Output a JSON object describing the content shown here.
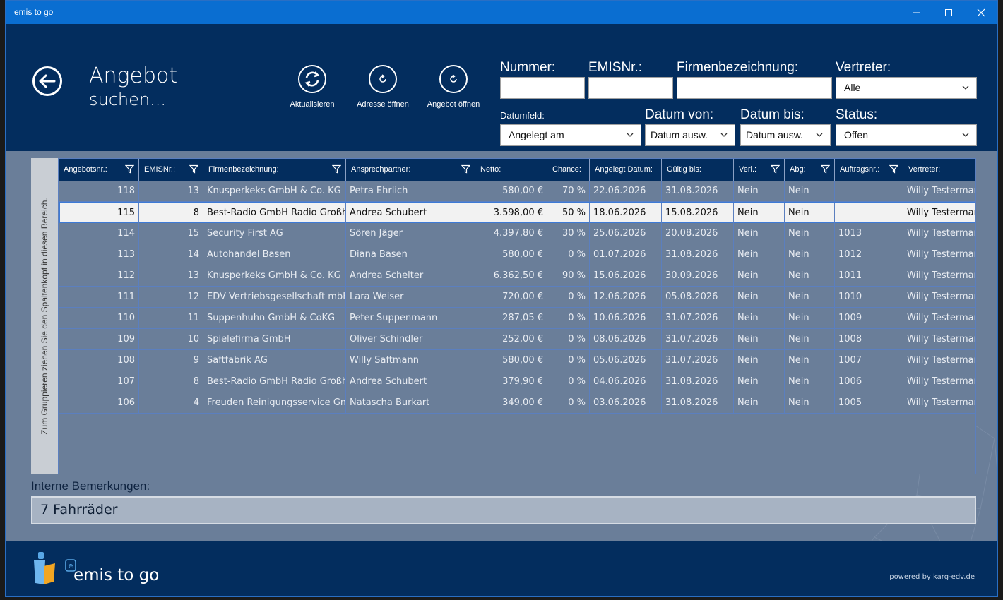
{
  "window": {
    "title": "emis to go",
    "controls": [
      "minimize",
      "maximize",
      "close"
    ]
  },
  "header": {
    "title_line1": "Angebot",
    "title_line2": "suchen...",
    "buttons": [
      {
        "label": "Aktualisieren",
        "icon": "refresh-icon"
      },
      {
        "label": "Adresse öffnen",
        "icon": "refresh-small-icon"
      },
      {
        "label": "Angebot öffnen",
        "icon": "refresh-small-icon"
      }
    ]
  },
  "filters": {
    "nummer_label": "Nummer:",
    "nummer_value": "",
    "emisnr_label": "EMISNr.:",
    "emisnr_value": "",
    "firma_label": "Firmenbezeichnung:",
    "firma_value": "",
    "vertreter_label": "Vertreter:",
    "vertreter_value": "Alle",
    "datumfeld_label": "Datumfeld:",
    "datumfeld_value": "Angelegt am",
    "datum_von_label": "Datum von:",
    "datum_von_value": "Datum ausw.",
    "datum_bis_label": "Datum bis:",
    "datum_bis_value": "Datum ausw.",
    "status_label": "Status:",
    "status_value": "Offen"
  },
  "grid": {
    "group_hint": "Zum Gruppieren ziehen Sie den Spaltenkopf in diesen Bereich.",
    "columns": [
      {
        "label": "Angebotsnr.:",
        "filter": true
      },
      {
        "label": "EMISNr.:",
        "filter": true
      },
      {
        "label": "Firmenbezeichnung:",
        "filter": true
      },
      {
        "label": "Ansprechpartner:",
        "filter": true
      },
      {
        "label": "Netto:",
        "filter": false
      },
      {
        "label": "Chance:",
        "filter": false
      },
      {
        "label": "Angelegt Datum:",
        "filter": false
      },
      {
        "label": "Gültig bis:",
        "filter": false
      },
      {
        "label": "Verl.:",
        "filter": true
      },
      {
        "label": "Abg:",
        "filter": true
      },
      {
        "label": "Auftragsnr.:",
        "filter": true
      },
      {
        "label": "Vertreter:",
        "filter": false
      }
    ],
    "selected_row": 1,
    "rows": [
      [
        "118",
        "13",
        "Knusperkeks GmbH & Co. KG",
        "Petra Ehrlich",
        "580,00 €",
        "70 %",
        "22.06.2026",
        "31.08.2026",
        "Nein",
        "Nein",
        "",
        "Willy Testermann"
      ],
      [
        "115",
        "8",
        "Best-Radio GmbH Radio Großhandel",
        "Andrea Schubert",
        "3.598,00 €",
        "50 %",
        "18.06.2026",
        "15.08.2026",
        "Nein",
        "Nein",
        "",
        "Willy Testermann"
      ],
      [
        "114",
        "15",
        "Security First AG",
        "Sören Jäger",
        "4.397,80 €",
        "30 %",
        "25.06.2026",
        "20.08.2026",
        "Nein",
        "Nein",
        "1013",
        "Willy Testermann"
      ],
      [
        "113",
        "14",
        "Autohandel Basen",
        "Diana Basen",
        "580,00 €",
        "0 %",
        "01.07.2026",
        "31.08.2026",
        "Nein",
        "Nein",
        "1012",
        "Willy Testermann"
      ],
      [
        "112",
        "13",
        "Knusperkeks GmbH & Co. KG",
        "Andrea Schelter",
        "6.362,50 €",
        "90 %",
        "15.06.2026",
        "30.09.2026",
        "Nein",
        "Nein",
        "1011",
        "Willy Testermann"
      ],
      [
        "111",
        "12",
        "EDV Vertriebsgesellschaft mbH",
        "Lara Weiser",
        "720,00 €",
        "0 %",
        "12.06.2026",
        "05.08.2026",
        "Nein",
        "Nein",
        "1010",
        "Willy Testermann"
      ],
      [
        "110",
        "11",
        "Suppenhuhn GmbH & CoKG",
        "Peter Suppenmann",
        "287,05 €",
        "0 %",
        "10.06.2026",
        "31.07.2026",
        "Nein",
        "Nein",
        "1009",
        "Willy Testermann"
      ],
      [
        "109",
        "10",
        "Spielefirma GmbH",
        "Oliver Schindler",
        "252,00 €",
        "0 %",
        "08.06.2026",
        "31.07.2026",
        "Nein",
        "Nein",
        "1008",
        "Willy Testermann"
      ],
      [
        "108",
        "9",
        "Saftfabrik AG",
        "Willy Saftmann",
        "580,00 €",
        "0 %",
        "05.06.2026",
        "31.07.2026",
        "Nein",
        "Nein",
        "1007",
        "Willy Testermann"
      ],
      [
        "107",
        "8",
        "Best-Radio GmbH Radio Großhandel",
        "Andrea Schubert",
        "379,90 €",
        "0 %",
        "04.06.2026",
        "31.08.2026",
        "Nein",
        "Nein",
        "1006",
        "Willy Testermann"
      ],
      [
        "106",
        "4",
        "Freuden Reinigungsservice GmbH",
        "Natascha Burkart",
        "349,00 €",
        "0 %",
        "03.06.2026",
        "31.08.2026",
        "Nein",
        "Nein",
        "1005",
        "Willy Testermann"
      ]
    ]
  },
  "notes": {
    "label": "Interne Bemerkungen:",
    "value": "7 Fahrräder"
  },
  "footer": {
    "brand": "emis to go",
    "powered": "powered by karg-edv.de"
  },
  "colors": {
    "titlebar": "#0a6ed1",
    "header": "#032d5e",
    "body": "#6a7e99",
    "selection": "#3d7ad6"
  }
}
